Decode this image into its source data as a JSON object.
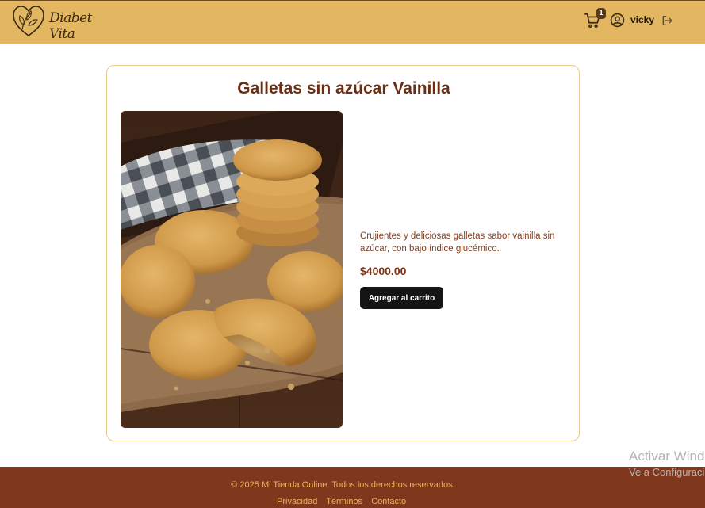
{
  "header": {
    "logo_text": "Diabet Vita",
    "cart_count": "1",
    "username": "vicky",
    "bg_color": "#e3b661"
  },
  "product": {
    "title": "Galletas sin azúcar Vainilla",
    "description": "Crujientes y deliciosas galletas sabor vainilla sin azúcar, con bajo índice glucémico.",
    "price": "$4000.00",
    "add_to_cart_label": "Agregar al carrito"
  },
  "footer": {
    "copyright": "© 2025 Mi Tienda Online. Todos los derechos reservados.",
    "links": [
      "Privacidad",
      "Términos",
      "Contacto"
    ],
    "bg_color": "#7f371d",
    "text_color": "#e9b45d"
  },
  "watermark": {
    "title": "Activar Windows",
    "subtitle": "Ve a Configuración"
  },
  "icons": {
    "logo": "heart-leaf-icon",
    "cart": "cart-icon",
    "user": "user-circle-icon",
    "logout": "logout-icon"
  }
}
